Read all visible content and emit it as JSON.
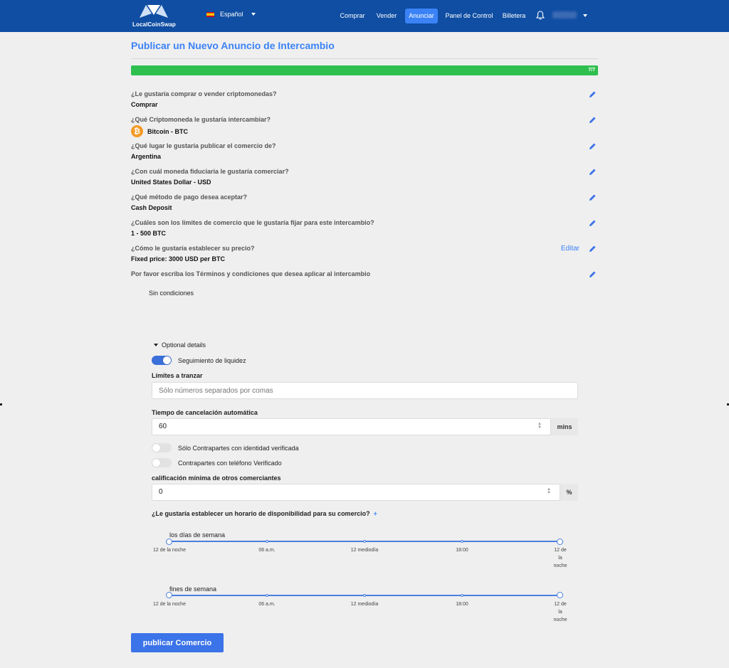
{
  "nav": {
    "logo_text": "LocalCoinSwap",
    "language": "Español",
    "links": [
      {
        "label": "Comprar"
      },
      {
        "label": "Vender"
      },
      {
        "label": "Anunciar"
      },
      {
        "label": "Panel de Control"
      },
      {
        "label": "Billetera"
      }
    ],
    "active_link": "Anunciar"
  },
  "page": {
    "title": "Publicar un Nuevo Anuncio de Intercambio",
    "progress_label": "7/7",
    "progress_fraction": 1.0
  },
  "summary": [
    {
      "question": "¿Le gustaría comprar o vender criptomonedas?",
      "answer": "Comprar"
    },
    {
      "question": "¿Qué Criptomoneda le gustaría intercambiar?",
      "answer": "Bitcoin - BTC",
      "icon": "bitcoin-icon"
    },
    {
      "question": "¿Qué lugar le gustaría publicar el comercio de?",
      "answer": "Argentina"
    },
    {
      "question": "¿Con cuál moneda fiduciaria le gustaría comerciar?",
      "answer": "United States Dollar - USD"
    },
    {
      "question": "¿Qué método de pago desea aceptar?",
      "answer": "Cash Deposit"
    },
    {
      "question": "¿Cuáles son los límites de comercio que le gustaría fijar para este intercambio?",
      "answer": "1 - 500 BTC"
    },
    {
      "question": "¿Cómo le gustaría establecer su precio?",
      "answer": "Fixed price: 3000 USD per BTC",
      "edit_label": "Editar"
    },
    {
      "question": "Por favor escriba los Términos y condiciones que desea aplicar al intercambio",
      "answer": ""
    }
  ],
  "terms_text": "Sin condiciones",
  "optional": {
    "toggle_label": "Optional details",
    "liquidity_label": "Seguimiento de liquidez",
    "liquidity_on": true,
    "limits_label": "Límites a tranzar",
    "limits_placeholder": "Sólo números separados por comas",
    "cancel_label": "Tiempo de cancelación automática",
    "cancel_value": "60",
    "cancel_unit": "mins",
    "verified_id_label": "Sólo Contrapartes con identidad verificada",
    "verified_id_on": false,
    "verified_phone_label": "Contrapartes con teléfono Verificado",
    "verified_phone_on": false,
    "rating_label": "calificación mínima de otros comerciantes",
    "rating_value": "0",
    "rating_unit": "%"
  },
  "schedule": {
    "question": "¿Le gustaría establecer un horario de disponibilidad para su comercio?",
    "plus": "+",
    "sliders": [
      {
        "label": "los días de semana",
        "ticks": [
          "12 de la noche",
          "06 a.m.",
          "12 mediodía",
          "18:00",
          "12 de la noche"
        ]
      },
      {
        "label": "fines de semana",
        "ticks": [
          "12 de la noche",
          "06 a.m.",
          "12 mediodía",
          "18:00",
          "12 de la noche"
        ]
      }
    ]
  },
  "publish_label": "publicar Comercio",
  "colors": {
    "navbar": "#0f4ea3",
    "accent": "#3b82f6",
    "progress": "#2fbf4f"
  }
}
